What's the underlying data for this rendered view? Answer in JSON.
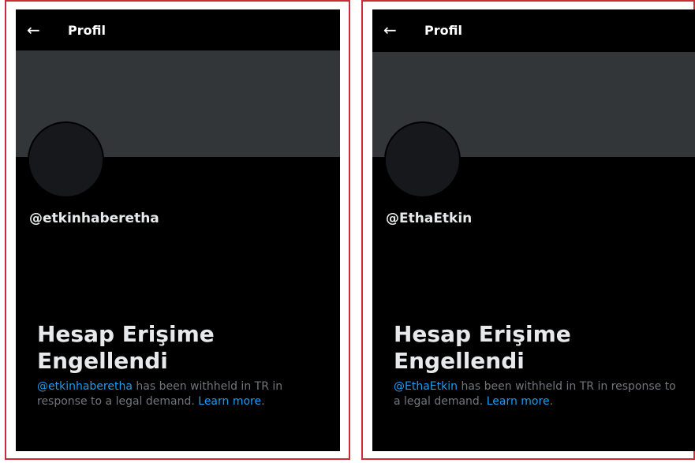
{
  "panels": [
    {
      "topbar": {
        "title": "Profil",
        "back_icon": "←"
      },
      "handle": "@etkinhaberetha",
      "withheld": {
        "title": "Hesap Erişime Engellendi",
        "mention": "@etkinhaberetha",
        "text": " has been withheld in TR in response to a legal demand. ",
        "learn_more": "Learn more",
        "period": "."
      }
    },
    {
      "topbar": {
        "title": "Profil",
        "back_icon": "←"
      },
      "handle": "@EthaEtkin",
      "withheld": {
        "title": "Hesap Erişime Engellendi",
        "mention": "@EthaEtkin",
        "text": " has been withheld in TR in response to a legal demand. ",
        "learn_more": "Learn more",
        "period": "."
      }
    }
  ],
  "colors": {
    "frame_border": "#cc2b3a",
    "banner": "#333639",
    "link": "#1d9bf0",
    "muted_text": "#71767b"
  }
}
